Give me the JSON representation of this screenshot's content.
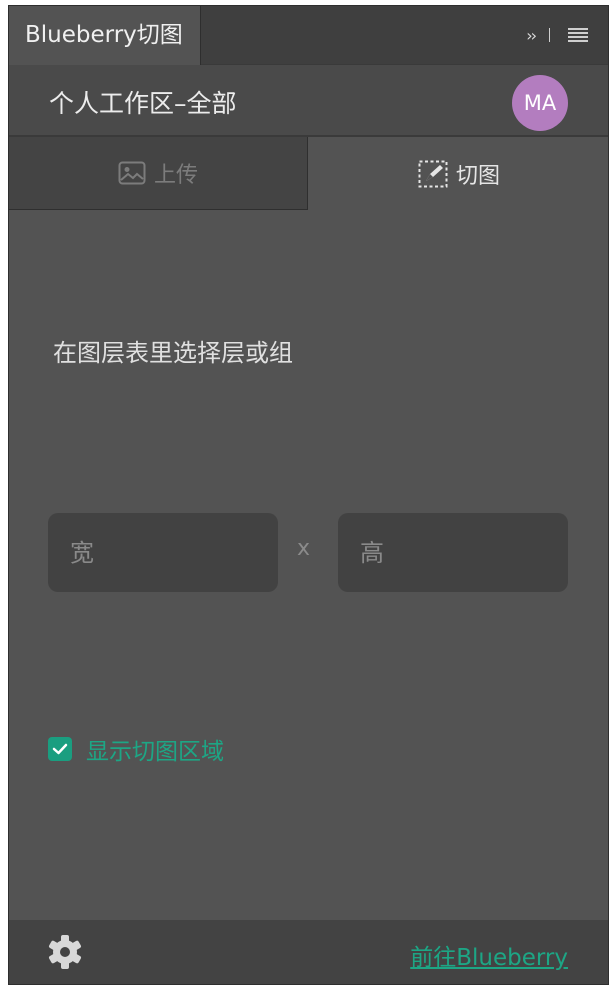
{
  "panel": {
    "tab_title": "Blueberry切图",
    "collapse_glyph": "››"
  },
  "workspace": {
    "title": "个人工作区–全部",
    "avatar_initials": "MA",
    "avatar_color": "#b37dbf"
  },
  "tabs": [
    {
      "label": "上传",
      "icon": "image-icon",
      "active": false
    },
    {
      "label": "切图",
      "icon": "slice-icon",
      "active": true
    }
  ],
  "instruction": "在图层表里选择层或组",
  "dimensions": {
    "width_placeholder": "宽",
    "height_placeholder": "高",
    "separator": "x"
  },
  "show_slice_area": {
    "label": "显示切图区域",
    "checked": true,
    "color": "#1da685"
  },
  "footer": {
    "settings_icon": "gear-icon",
    "link_label": "前往Blueberry"
  }
}
